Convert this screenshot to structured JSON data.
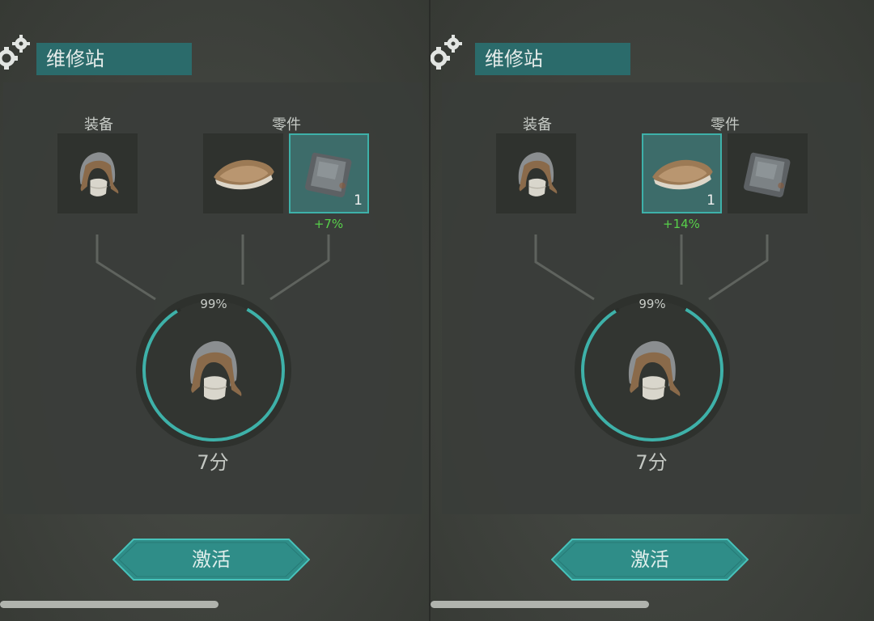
{
  "colors": {
    "accent": "#3eb1a9",
    "title_bg": "#2b6b6b",
    "bonus_green": "#57d04a"
  },
  "panels": [
    {
      "title": "维修站",
      "equipment_label": "装备",
      "parts_label": "零件",
      "equipment": {
        "icon": "fur-hat-icon"
      },
      "parts": [
        {
          "icon": "fur-pelt-icon",
          "selected": false,
          "quantity": "",
          "bonus": ""
        },
        {
          "icon": "metal-plate-icon",
          "selected": true,
          "quantity": "1",
          "bonus": "+7%"
        }
      ],
      "durability": "99%",
      "durability_fraction": 0.99,
      "time": "7分",
      "activate_label": "激活"
    },
    {
      "title": "维修站",
      "equipment_label": "装备",
      "parts_label": "零件",
      "equipment": {
        "icon": "fur-hat-icon"
      },
      "parts": [
        {
          "icon": "fur-pelt-icon",
          "selected": true,
          "quantity": "1",
          "bonus": "+14%"
        },
        {
          "icon": "metal-plate-icon",
          "selected": false,
          "quantity": "",
          "bonus": ""
        }
      ],
      "durability": "99%",
      "durability_fraction": 0.99,
      "time": "7分",
      "activate_label": "激活"
    }
  ]
}
